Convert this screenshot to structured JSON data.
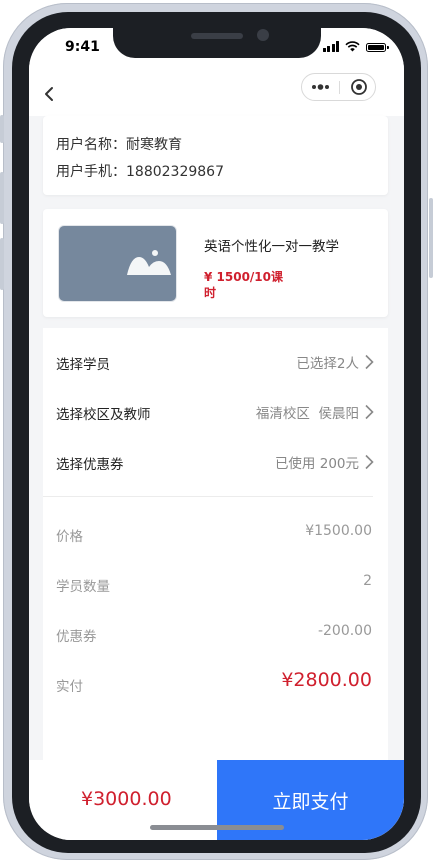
{
  "status_bar": {
    "time": "9:41"
  },
  "user": {
    "name_line": "用户名称：耐寒教育",
    "phone_line": "用户手机：18802329867"
  },
  "course": {
    "title": "英语个性化一对一教学",
    "price": "¥ 1500/10课时"
  },
  "options": [
    {
      "label": "选择学员",
      "value": "已选择2人"
    },
    {
      "label": "选择校区及教师",
      "value": "福清校区  侯晨阳"
    },
    {
      "label": "选择优惠券",
      "value": "已使用 200元"
    }
  ],
  "summary": {
    "price_label": "价格",
    "price_value": "¥1500.00",
    "count_label": "学员数量",
    "count_value": "2",
    "coupon_label": "优惠券",
    "coupon_value": "-200.00",
    "actual_label": "实付",
    "actual_value": "¥2800.00"
  },
  "bottom": {
    "total": "¥3000.00",
    "pay_label": "立即支付"
  },
  "colors": {
    "accent_red": "#d0202e",
    "pay_blue": "#2f76f9",
    "thumb_bg": "#76889d"
  },
  "icons": [
    "back-arrow-icon",
    "more-dots-icon",
    "close-target-icon",
    "image-placeholder-icon",
    "chevron-right-icon",
    "signal-icon",
    "wifi-icon",
    "battery-icon"
  ]
}
